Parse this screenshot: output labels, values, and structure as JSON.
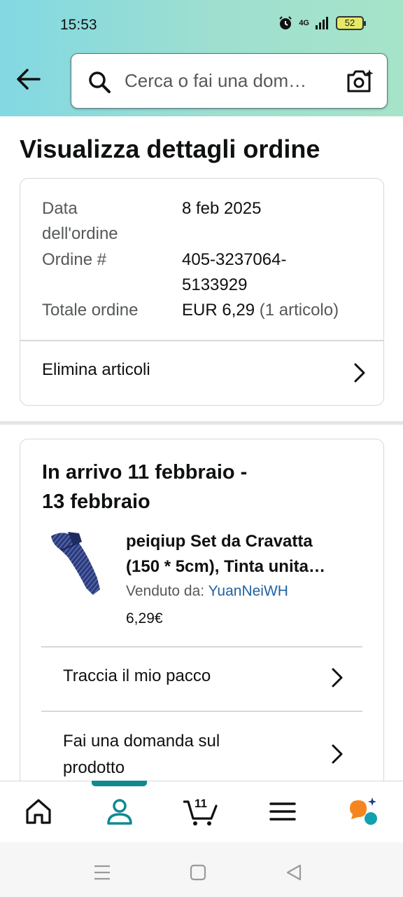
{
  "status_bar": {
    "time": "15:53",
    "network": "4G",
    "battery": "52"
  },
  "header": {
    "search_placeholder": "Cerca o fai una dom…",
    "icons": [
      "back-arrow-icon",
      "search-icon",
      "camera-icon"
    ]
  },
  "page": {
    "title": "Visualizza dettagli ordine"
  },
  "order_summary": {
    "date_label_line1": "Data",
    "date_label_line2": "dell'ordine",
    "date_value": "8 feb 2025",
    "order_label": "Ordine #",
    "order_value_line1": "405-3237064-",
    "order_value_line2": "5133929",
    "total_label": "Totale ordine",
    "total_value": "EUR 6,29",
    "total_count": "(1 articolo)",
    "remove_items": "Elimina articoli"
  },
  "shipment": {
    "arrival_line1": "In arrivo 11 febbraio -",
    "arrival_line2": "13 febbraio",
    "product_title_line1": "peiqiup Set da Cravatta",
    "product_title_line2": "(150 * 5cm), Tinta unita…",
    "sold_by_label": "Venduto da:",
    "seller": "YuanNeiWH",
    "price": "6,29€",
    "actions": [
      {
        "label": "Traccia il mio pacco"
      },
      {
        "label_line1": "Fai una domanda sul",
        "label_line2": "prodotto"
      }
    ]
  },
  "bottom_nav": {
    "items": [
      "home-icon",
      "account-icon",
      "cart-icon",
      "menu-icon",
      "rufus-icon"
    ],
    "cart_count": "11",
    "active": "account-icon"
  },
  "colors": {
    "accent": "#0f8a8f",
    "link": "#2162a1",
    "text": "#0f1111",
    "muted": "#565959",
    "border": "#d5d9d9",
    "rufus_orange": "#f5861f"
  }
}
